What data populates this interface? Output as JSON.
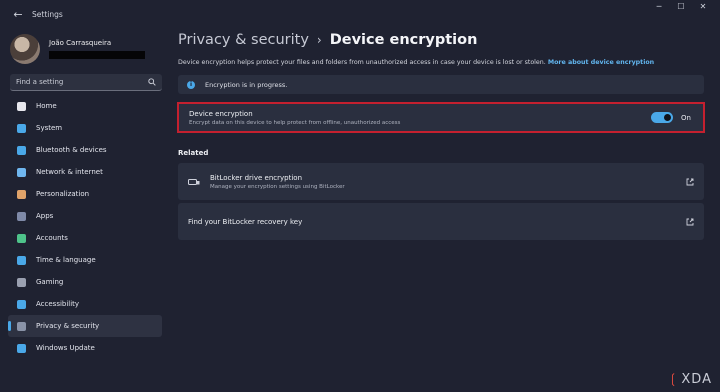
{
  "window": {
    "back_glyph": "←",
    "title": "Settings",
    "controls": {
      "minimize": "─",
      "maximize": "☐",
      "close": "✕"
    }
  },
  "profile": {
    "name": "João Carrasqueira"
  },
  "search": {
    "placeholder": "Find a setting"
  },
  "nav": {
    "items": [
      {
        "label": "Home",
        "icon": "home-icon",
        "color": "#e8e8ee"
      },
      {
        "label": "System",
        "icon": "system-icon",
        "color": "#4aa8e8"
      },
      {
        "label": "Bluetooth & devices",
        "icon": "bluetooth-icon",
        "color": "#4aa8e8"
      },
      {
        "label": "Network & internet",
        "icon": "network-icon",
        "color": "#6fb6ef"
      },
      {
        "label": "Personalization",
        "icon": "brush-icon",
        "color": "#e0a36a"
      },
      {
        "label": "Apps",
        "icon": "apps-icon",
        "color": "#7f8aa8"
      },
      {
        "label": "Accounts",
        "icon": "accounts-icon",
        "color": "#4ec38a"
      },
      {
        "label": "Time & language",
        "icon": "globe-icon",
        "color": "#4aa8e8"
      },
      {
        "label": "Gaming",
        "icon": "gaming-icon",
        "color": "#9aa0b0"
      },
      {
        "label": "Accessibility",
        "icon": "accessibility-icon",
        "color": "#4aa8e8"
      },
      {
        "label": "Privacy & security",
        "icon": "shield-icon",
        "color": "#8a93a8",
        "active": true
      },
      {
        "label": "Windows Update",
        "icon": "update-icon",
        "color": "#4aa8e8"
      }
    ]
  },
  "main": {
    "breadcrumb_parent": "Privacy & security",
    "breadcrumb_sep": "›",
    "breadcrumb_current": "Device encryption",
    "description": "Device encryption helps protect your files and folders from unauthorized access in case your device is lost or stolen.",
    "description_link": "More about device encryption",
    "info_text": "Encryption is in progress.",
    "encryption": {
      "title": "Device encryption",
      "subtitle": "Encrypt data on this device to help protect from offline, unauthorized access",
      "toggle_state": "On",
      "enabled": true
    },
    "related_heading": "Related",
    "related": [
      {
        "title": "BitLocker drive encryption",
        "subtitle": "Manage your encryption settings using BitLocker"
      },
      {
        "title": "Find your BitLocker recovery key"
      }
    ]
  },
  "watermark": {
    "bracket": "❲",
    "text": "XDA"
  },
  "colors": {
    "accent": "#4aa8e8",
    "highlight_border": "#c4202f",
    "link": "#62b6ef"
  }
}
